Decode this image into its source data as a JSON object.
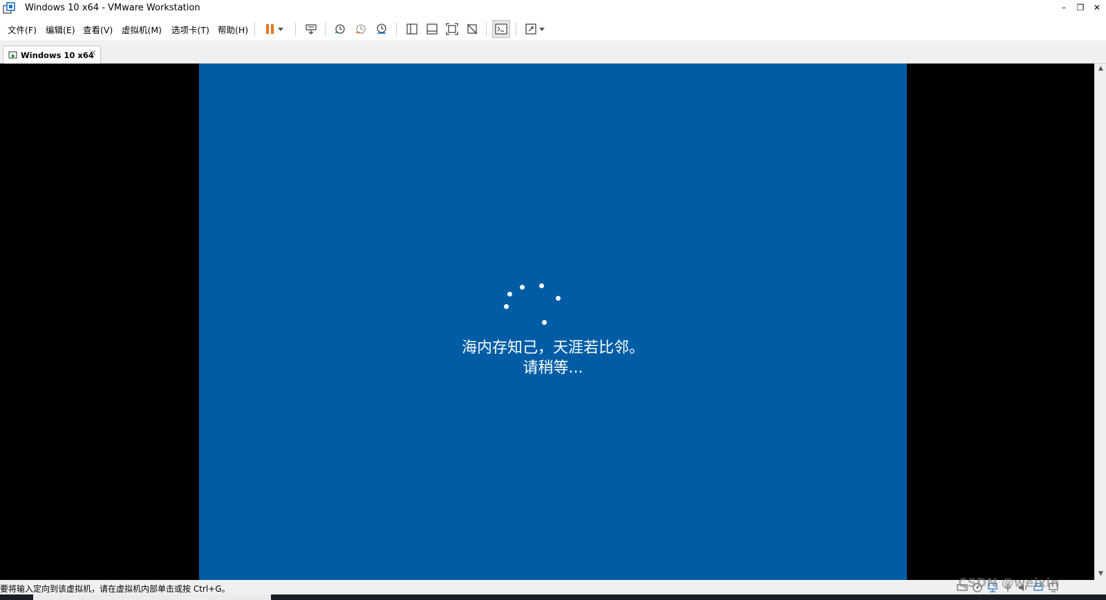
{
  "window": {
    "title": "Windows 10 x64 - VMware Workstation",
    "minimize_glyph": "–",
    "maximize_glyph": "❐",
    "close_glyph": "✕"
  },
  "menu": {
    "items": [
      "文件(F)",
      "编辑(E)",
      "查看(V)",
      "虚拟机(M)",
      "选项卡(T)",
      "帮助(H)"
    ]
  },
  "toolbar": {
    "icons": [
      "pause-icon",
      "dropdown-arrow-icon",
      "send-ctrl-alt-del-icon",
      "snapshot-take-icon",
      "snapshot-revert-icon",
      "snapshot-manager-icon",
      "show-library-icon",
      "show-thumbnail-bar-icon",
      "full-screen-icon",
      "unity-icon",
      "console-view-icon",
      "stretch-guest-icon",
      "dropdown-arrow-icon"
    ],
    "accent": "#e8731d"
  },
  "tabs": [
    {
      "label": "Windows 10 x64",
      "active": true,
      "close_glyph": "✕"
    }
  ],
  "guest": {
    "background": "#005da5",
    "message_line1": "海内存知己，天涯若比邻。",
    "message_line2": "请稍等..."
  },
  "status": {
    "text": "要将输入定向到该虚拟机，请在虚拟机内部单击或按 Ctrl+G。",
    "tray_icons": [
      "hard-disk-icon",
      "cd-dvd-icon",
      "network-icon",
      "usb-icon",
      "sound-icon",
      "printer-icon",
      "display-icon"
    ]
  },
  "overlay": {
    "watermark": "CSDN @weixin"
  },
  "colors": {
    "console": "#000000",
    "status_bar": "#f0f0f0"
  }
}
